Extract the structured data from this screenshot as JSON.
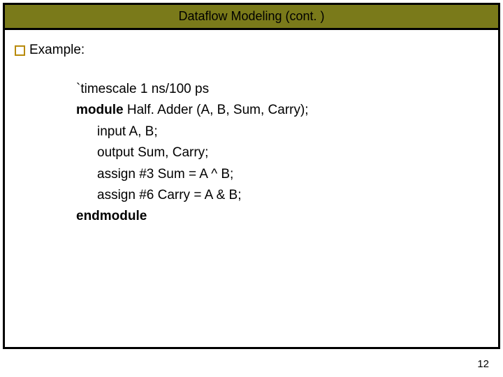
{
  "slide": {
    "title": "Dataflow Modeling (cont. )",
    "bullet_label": "Example:",
    "code": {
      "line1_pre": "`timescale ",
      "line1_rest": "1 ns/100 ps",
      "line2_kw": "module ",
      "line2_rest": "Half. Adder (A, B, Sum, Carry);",
      "line3_kw": "input ",
      "line3_rest": "A, B;",
      "line4_kw": "output ",
      "line4_rest": "Sum, Carry;",
      "line5_kw": "assign ",
      "line5_rest": "#3 Sum = A ^ B;",
      "line6_kw": "assign ",
      "line6_rest": "#6 Carry = A & B;",
      "line7_kw": "endmodule"
    },
    "page_number": "12"
  }
}
